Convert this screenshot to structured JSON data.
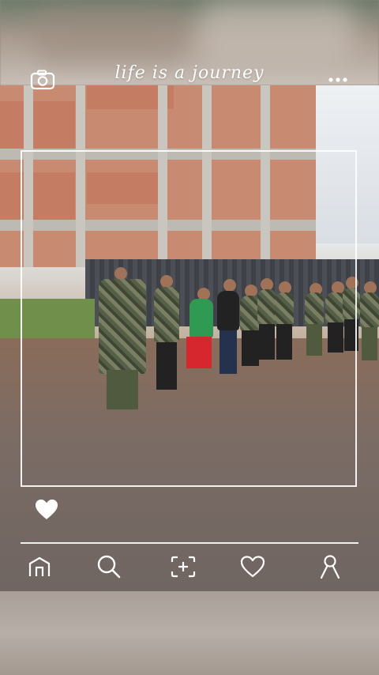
{
  "header": {
    "title": "life is a journey",
    "camera_icon": "camera-icon",
    "more_icon": "more-dots-icon"
  },
  "like": {
    "icon": "heart-filled-icon"
  },
  "nav": {
    "items": [
      {
        "icon": "home-icon"
      },
      {
        "icon": "search-icon"
      },
      {
        "icon": "add-frame-icon"
      },
      {
        "icon": "heart-outline-icon"
      },
      {
        "icon": "profile-icon"
      }
    ]
  },
  "colors": {
    "frame": "#ffffff",
    "icon": "#ffffff"
  }
}
